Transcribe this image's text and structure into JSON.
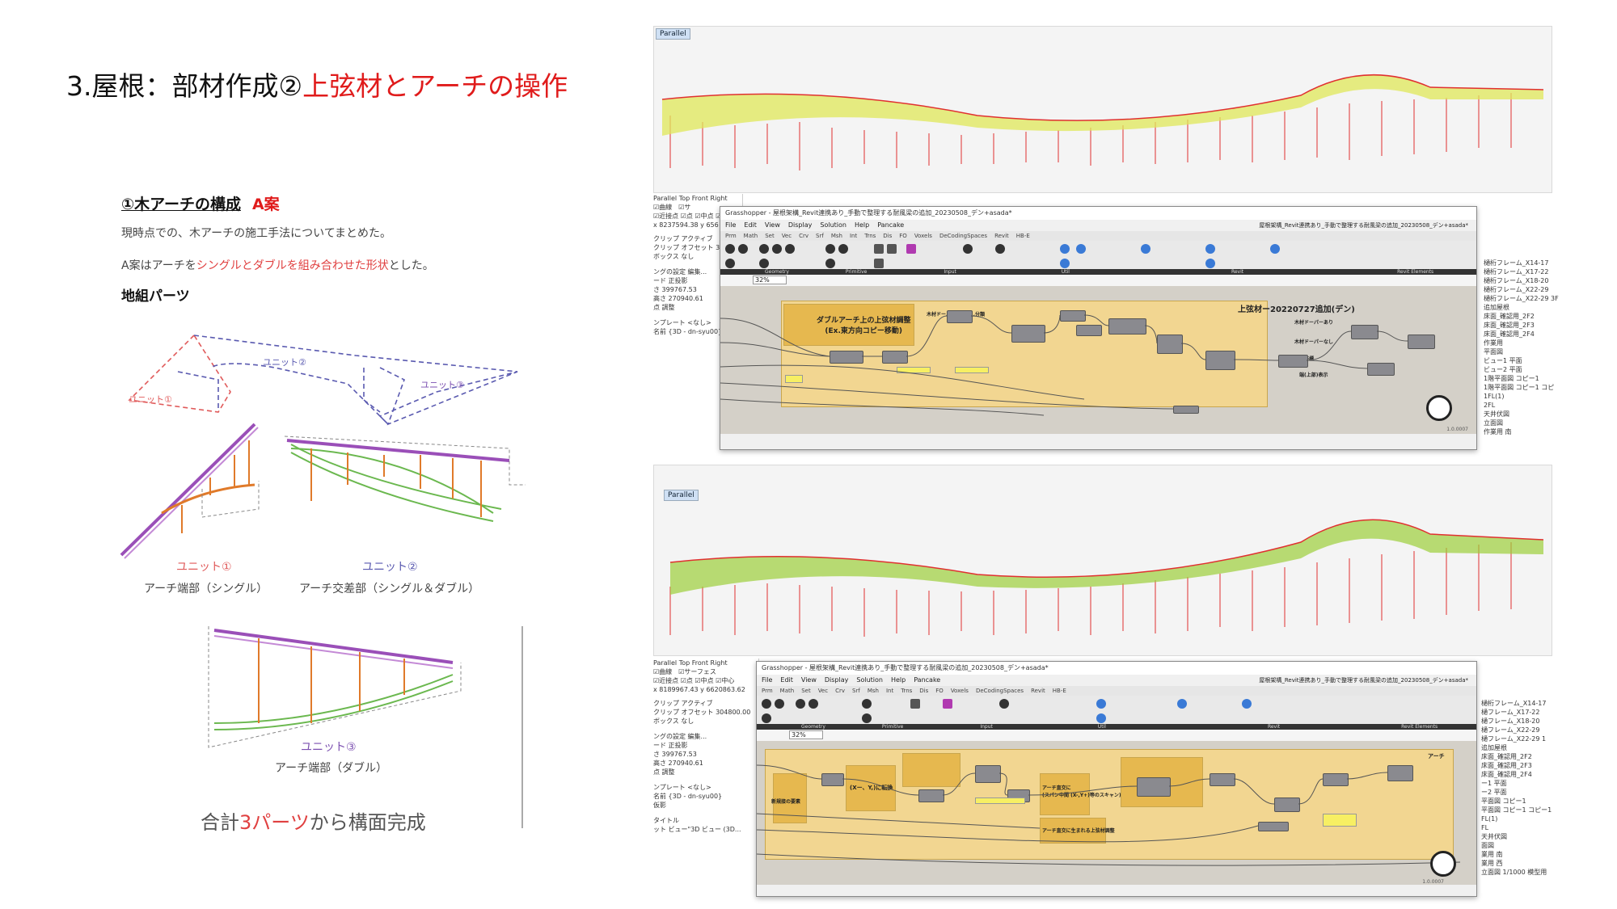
{
  "title": {
    "prefix": "3.屋根：部材作成②",
    "highlight": "上弦材とアーチの操作"
  },
  "section": {
    "heading": "①木アーチの構成",
    "plan": "A案"
  },
  "desc1": "現時点での、木アーチの施工手法についてまとめた。",
  "desc2": {
    "before": "A案はアーチを",
    "highlight": "シングルとダブルを組み合わせた形状",
    "after": "とした。"
  },
  "parts_heading": "地組パーツ",
  "units": {
    "u1": "ユニット①",
    "u2": "ユニット②",
    "u3": "ユニット③",
    "cap1": "アーチ端部（シングル）",
    "cap2": "アーチ交差部（シングル＆ダブル）",
    "cap3": "アーチ端部（ダブル）"
  },
  "total": {
    "before": "合計",
    "highlight": "3パーツ",
    "after": "から構面完成"
  },
  "viewport_tag": "Parallel",
  "rhino_tabs": "Parallel  Top  Front  Right",
  "rhino_checks1": "☑曲線　☑サ",
  "rhino_checks2": "☑曲線　☑サーフェス",
  "rhino_snap": "☑近接点 ☑点 ☑中点 ☑中心",
  "coords_top": "x 8237594.38  y 656",
  "coords_bottom": "x 8189967.43  y 6620863.62",
  "left_panel": [
    "クリップ アクティブ",
    "クリップ オフセット 304800.00",
    "ボックス なし",
    "",
    "ングの設定 編集...",
    "ード 正投影",
    "さ 399767.53",
    "高さ 270940.61",
    "点 調整",
    "",
    "ンプレート <なし>",
    "名前 {3D - dn-syu00}",
    "仮影",
    "",
    "タイトル",
    "ット ビュー\"3D ビュー (3D..."
  ],
  "gh": {
    "title_top": "Grasshopper - 屋根架構_Revit連携あり_手動で整理する耐風梁の追加_20230508_デン+asada*",
    "title_right": "屋根架構_Revit連携あり_手動で整理する耐風梁の追加_20230508_デン+asada*",
    "menu": [
      "File",
      "Edit",
      "View",
      "Display",
      "Solution",
      "Help",
      "Pancake"
    ],
    "tabs": [
      "Prm",
      "Math",
      "Set",
      "Vec",
      "Crv",
      "Srf",
      "Msh",
      "Int",
      "Trns",
      "Dis",
      "FO",
      "Voxels",
      "DeCodingSpaces",
      "Revit",
      "HB-E",
      "P",
      "M",
      "W",
      "W",
      "H",
      "L",
      "P",
      "H",
      "L",
      "Q",
      "B",
      "O",
      "C",
      "E",
      "M",
      "C",
      "T",
      "W",
      "P",
      "M",
      "W",
      "S",
      "A"
    ],
    "panels": [
      "Geometry",
      "Primitive",
      "Input",
      "Util",
      "Revit",
      "Revit Elements"
    ],
    "zoom": "32%",
    "version": "1.0.0007",
    "group1_label": "ダブルアーチ上の上弦材調整\n(Ex.東方向コピー移動)",
    "group2_label": "上弦材ー20220727追加(デン)",
    "mini_labels": [
      "木材ドーパーありなし分類",
      "木材ドーパーあり",
      "木材ドーパーなし",
      "座標",
      "端(上部)表示"
    ],
    "bottom_labels": [
      "(Xー、Y,)に転換",
      "アーチ直交に生まれる上弦材調整",
      "アーチ直交に\n(スパン中間 (X-,Y+)等のスキャン)",
      "アーチ",
      "新規接の要素",
      "(X-、Y,)に転換",
      "アーチ直交に修正"
    ]
  },
  "right_panel_top": [
    "樋桁フレーム_X14-17",
    "樋桁フレーム_X17-22",
    "樋桁フレーム_X18-20",
    "樋桁フレーム_X22-29",
    "樋桁フレーム_X22-29 3F",
    "追加屋根",
    "床面_確認用_2F2",
    "床面_確認用_2F3",
    "床面_確認用_2F4",
    "作業用",
    "平面図",
    "ビュー1 平面",
    "ビュー2 平面",
    "1階平面図 コピー1",
    "1階平面図 コピー1 コピ",
    "1FL(1)",
    "2FL",
    "天井伏図",
    "立面図",
    "作業用 南",
    "作業用 西",
    "南立面図 1/1000 模型"
  ],
  "right_panel_bottom": [
    "樋桁フレーム_X14-17",
    "樋フレーム_X17-22",
    "樋フレーム_X18-20",
    "樋フレーム_X22-29",
    "樋フレーム_X22-29 1",
    "追加屋根",
    "床面_確認用_2F2",
    "床面_確認用_2F3",
    "床面_確認用_2F4",
    "ー1 平面",
    "ー2 平面",
    "平面図 コピー1",
    "平面図 コピー1 コピー1",
    "FL(1)",
    "FL",
    "天井伏図",
    "面図",
    "業用 南",
    "業用 西",
    "立面図 1/1000 模型用"
  ],
  "colors": {
    "accent": "#e01b1b",
    "unit1": "#e05a5a",
    "unit2": "#5a5ab0",
    "unit3": "#7b4fb0",
    "gh_group": "#f2d691"
  }
}
